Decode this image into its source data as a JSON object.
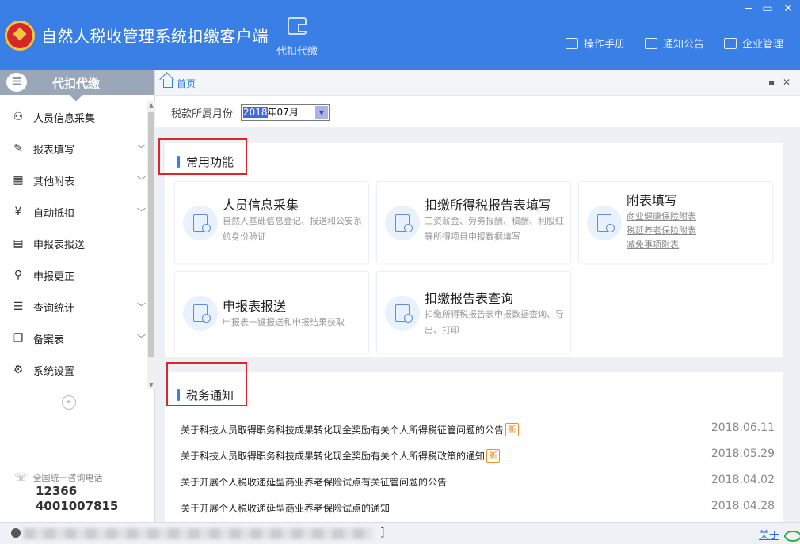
{
  "app": {
    "title": "自然人税收管理系统扣缴客户端",
    "module": "代扣代缴",
    "window_controls": [
      "−",
      "▭",
      "✕"
    ],
    "top_links": [
      {
        "label": "操作手册",
        "icon": "manual-icon"
      },
      {
        "label": "通知公告",
        "icon": "mail-icon"
      },
      {
        "label": "企业管理",
        "icon": "building-icon"
      }
    ]
  },
  "sidebar": {
    "header": "代扣代缴",
    "items": [
      {
        "label": "人员信息采集",
        "icon": "person-icon",
        "glyph": "⚇",
        "expandable": false
      },
      {
        "label": "报表填写",
        "icon": "edit-icon",
        "glyph": "✎",
        "expandable": true
      },
      {
        "label": "其他附表",
        "icon": "grid-icon",
        "glyph": "▦",
        "expandable": true
      },
      {
        "label": "自动抵扣",
        "icon": "yen-icon",
        "glyph": "¥",
        "expandable": true
      },
      {
        "label": "申报表报送",
        "icon": "report-send-icon",
        "glyph": "▤",
        "expandable": false
      },
      {
        "label": "申报更正",
        "icon": "search-icon",
        "glyph": "⚲",
        "expandable": false
      },
      {
        "label": "查询统计",
        "icon": "query-list-icon",
        "glyph": "☰",
        "expandable": true
      },
      {
        "label": "备案表",
        "icon": "document-icon",
        "glyph": "❐",
        "expandable": true
      },
      {
        "label": "系统设置",
        "icon": "gear-icon",
        "glyph": "⚙",
        "expandable": false
      }
    ],
    "collapse_glyph": "«",
    "hotline": {
      "label": "全国统一咨询电话",
      "numbers": [
        "12366",
        "4001007815"
      ]
    }
  },
  "tabs": {
    "home": "首页",
    "controls": [
      "▪",
      "✕"
    ]
  },
  "period": {
    "label": "税款所属月份",
    "year_selected": "2018",
    "rest": "年07月",
    "dropdown_glyph": "▼"
  },
  "common": {
    "title": "常用功能",
    "cards": [
      {
        "title": "人员信息采集",
        "desc": "自然人基础信息登记、报送和公安系统身份验证"
      },
      {
        "title": "扣缴所得税报告表填写",
        "desc": "工资薪金、劳务报酬、稿酬、利股红等所得项目申报数据填写"
      },
      {
        "title": "附表填写",
        "links": [
          "商业健康保险附表",
          "税延养老保险附表",
          "减免事项附表"
        ]
      },
      {
        "title": "申报表报送",
        "desc": "申报表一键报送和申报结果获取"
      },
      {
        "title": "扣缴报告表查询",
        "desc": "扣缴所得税报告表申报数据查询、导出、打印"
      }
    ]
  },
  "notices": {
    "title": "税务通知",
    "new_badge": "新",
    "items": [
      {
        "text": "关于科技人员取得职务科技成果转化现金奖励有关个人所得税征管问题的公告",
        "date": "2018.06.11",
        "is_new": true
      },
      {
        "text": "关于科技人员取得职务科技成果转化现金奖励有关个人所得税政策的通知",
        "date": "2018.05.29",
        "is_new": true
      },
      {
        "text": "关于开展个人税收递延型商业养老保险试点有关征管问题的公告",
        "date": "2018.04.02",
        "is_new": false
      },
      {
        "text": "关于开展个人税收递延型商业养老保险试点的通知",
        "date": "2018.04.28",
        "is_new": false
      }
    ]
  },
  "statusbar": {
    "bracket": "]",
    "about": "关于"
  },
  "colors": {
    "brand_blue": "#3a7fe6",
    "highlight_red": "#e0252a",
    "new_orange": "#e8912d"
  }
}
